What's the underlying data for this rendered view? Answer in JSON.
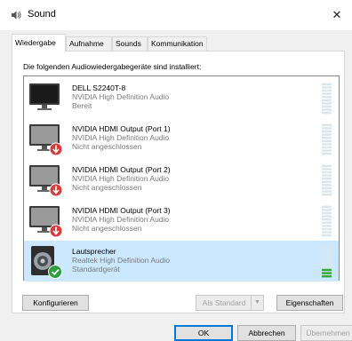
{
  "window": {
    "title": "Sound",
    "close_glyph": "✕"
  },
  "tabs": [
    {
      "label": "Wiedergabe",
      "active": true
    },
    {
      "label": "Aufnahme",
      "active": false
    },
    {
      "label": "Sounds",
      "active": false
    },
    {
      "label": "Kommunikation",
      "active": false
    }
  ],
  "panel": {
    "heading": "Die folgenden Audiowiedergabegeräte sind installiert:"
  },
  "devices": [
    {
      "name": "DELL S2240T-8",
      "driver": "NVIDIA High Definition Audio",
      "status": "Bereit",
      "icon": "monitor-icon",
      "badge": "none",
      "selected": false,
      "meter_level": 0.0
    },
    {
      "name": "NVIDIA HDMI Output (Port 1)",
      "driver": "NVIDIA High Definition Audio",
      "status": "Nicht angeschlossen",
      "icon": "monitor-icon",
      "badge": "unplugged",
      "selected": false,
      "meter_level": 0.0
    },
    {
      "name": "NVIDIA HDMI Output (Port 2)",
      "driver": "NVIDIA High Definition Audio",
      "status": "Nicht angeschlossen",
      "icon": "monitor-icon",
      "badge": "unplugged",
      "selected": false,
      "meter_level": 0.0
    },
    {
      "name": "NVIDIA HDMI Output (Port 3)",
      "driver": "NVIDIA High Definition Audio",
      "status": "Nicht angeschlossen",
      "icon": "monitor-icon",
      "badge": "unplugged",
      "selected": false,
      "meter_level": 0.0
    },
    {
      "name": "Lautsprecher",
      "driver": "Realtek High Definition Audio",
      "status": "Standardgerät",
      "icon": "speaker-icon",
      "badge": "default",
      "selected": true,
      "meter_level": 0.25
    }
  ],
  "buttons": {
    "configure": "Konfigurieren",
    "set_default": "Als Standard",
    "properties": "Eigenschaften",
    "ok": "OK",
    "cancel": "Abbrechen",
    "apply": "Übernehmen"
  },
  "colors": {
    "selection": "#cce8ff",
    "meter_idle": "#d8e6ee",
    "meter_active": "#37a837",
    "unplugged_badge": "#d83b3b",
    "default_badge": "#2f9e3f"
  }
}
